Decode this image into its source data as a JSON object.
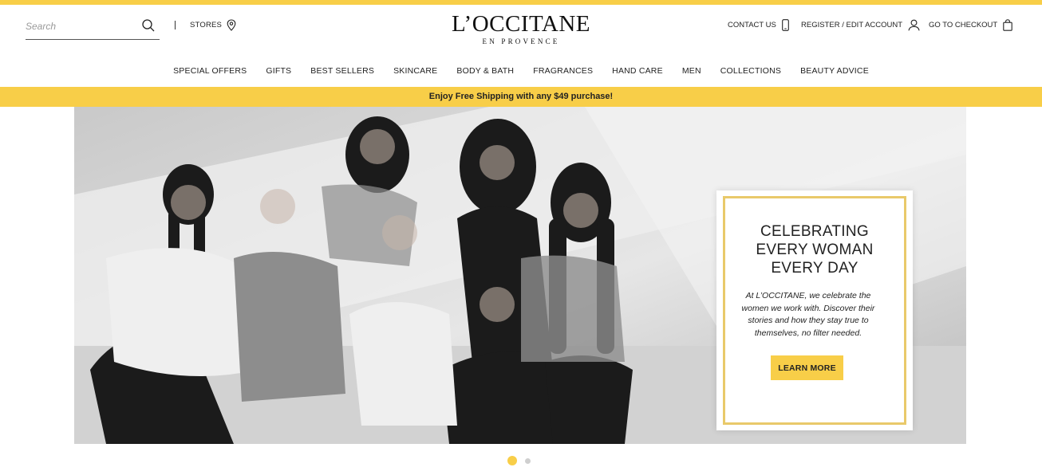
{
  "header": {
    "search": {
      "placeholder": "Search",
      "value": ""
    },
    "stores_label": "STORES",
    "logo": {
      "main": "L’OCCITANE",
      "sub": "EN PROVENCE"
    },
    "utility": {
      "contact_label": "CONTACT US",
      "register_label": "REGISTER / EDIT ACCOUNT",
      "checkout_label": "GO TO CHECKOUT"
    }
  },
  "nav": {
    "items": [
      {
        "label": "SPECIAL OFFERS"
      },
      {
        "label": "GIFTS"
      },
      {
        "label": "BEST SELLERS"
      },
      {
        "label": "SKINCARE"
      },
      {
        "label": "BODY & BATH"
      },
      {
        "label": "FRAGRANCES"
      },
      {
        "label": "HAND CARE"
      },
      {
        "label": "MEN"
      },
      {
        "label": "COLLECTIONS"
      },
      {
        "label": "BEAUTY ADVICE"
      }
    ]
  },
  "promo": {
    "text": "Enjoy Free Shipping with any $49 purchase!"
  },
  "hero": {
    "title_lines": [
      "CELEBRATING",
      "EVERY WOMAN",
      "EVERY DAY"
    ],
    "body": "At L’OCCITANE, we celebrate the women we work with. Discover their stories and how they stay true to themselves, no filter needed.",
    "cta_label": "LEARN MORE"
  },
  "carousel": {
    "active_slide": 1,
    "total_slides": 2
  },
  "colors": {
    "accent": "#f8ce48",
    "card_border": "#e9c96a",
    "text": "#222222"
  }
}
